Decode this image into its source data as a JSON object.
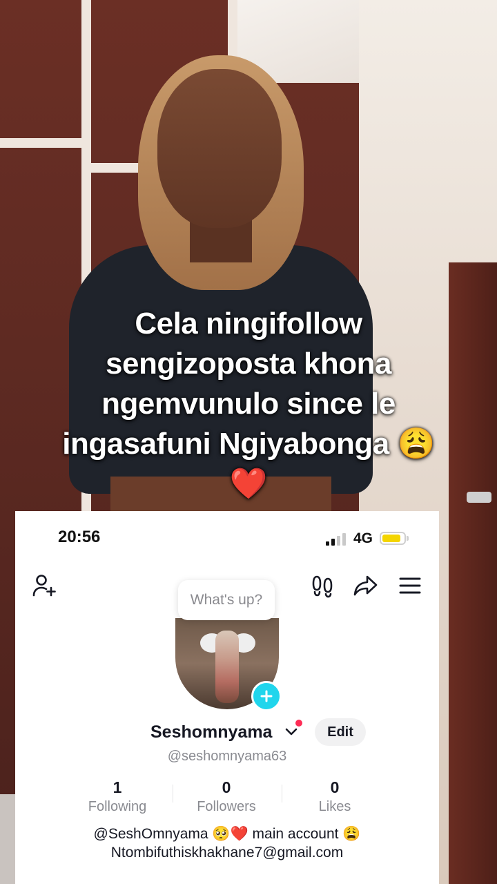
{
  "caption": {
    "line1": "Cela ningifollow",
    "line2": "sengizoposta khona",
    "line3": "ngemvunulo since le",
    "line4": "ingasafuni Ngiyabonga 😩",
    "line5": "❤️"
  },
  "status_bar": {
    "time": "20:56",
    "network": "4G",
    "battery_level": 0.85,
    "battery_color": "#f4d500"
  },
  "toolbar": {
    "add_friend_icon": "add-user-icon",
    "footprints_icon": "footprints-icon",
    "share_icon": "share-icon",
    "menu_icon": "menu-icon"
  },
  "note_bubble": "What's up?",
  "profile": {
    "display_name": "Seshomnyama",
    "handle": "@seshomnyama63",
    "edit_label": "Edit",
    "accent": "#20d5ec",
    "notify_color": "#fe2c55"
  },
  "stats": [
    {
      "value": "1",
      "label": "Following"
    },
    {
      "value": "0",
      "label": "Followers"
    },
    {
      "value": "0",
      "label": "Likes"
    }
  ],
  "bio": {
    "line1": "@SeshOmnyama 🥺❤️  main account 😩",
    "line2": "Ntombifuthiskhakhane7@gmail.com"
  }
}
